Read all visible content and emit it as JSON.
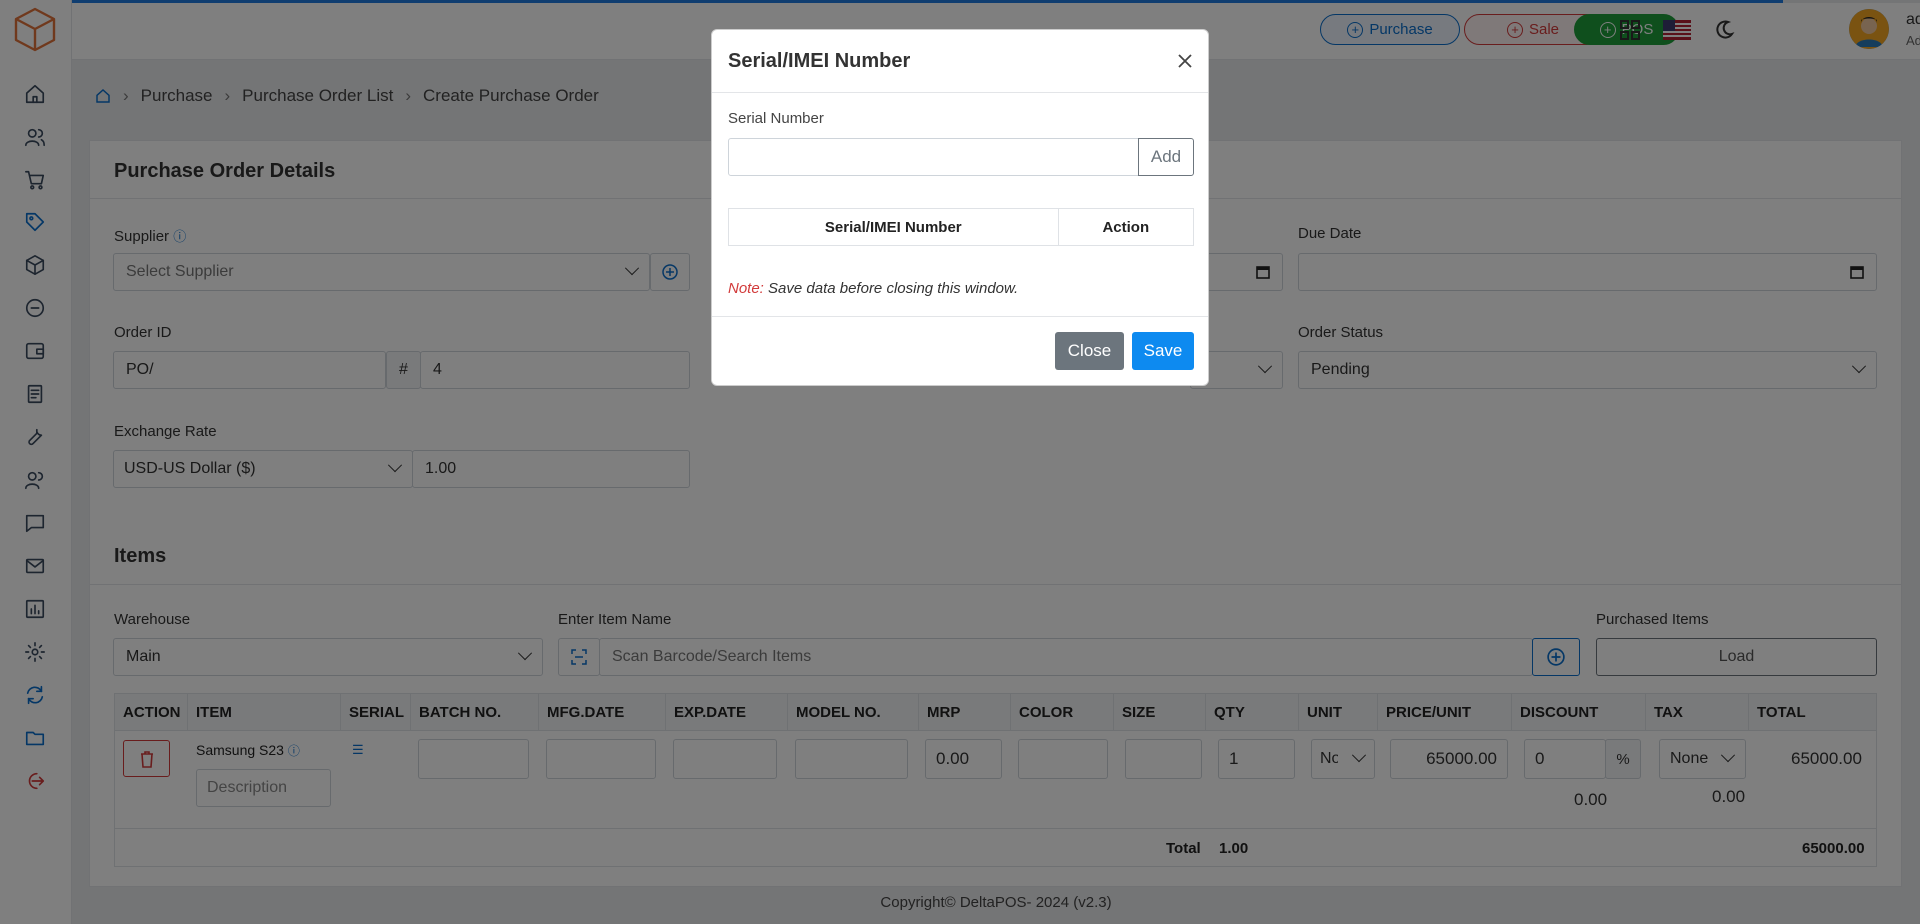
{
  "header": {
    "purchase_btn": "Purchase",
    "sale_btn": "Sale",
    "pos_btn": "POS",
    "user_name": "admin",
    "user_role": "Admin"
  },
  "breadcrumb": [
    "Purchase",
    "Purchase Order List",
    "Create Purchase Order"
  ],
  "details": {
    "title": "Purchase Order Details",
    "supplier_label": "Supplier",
    "supplier_placeholder": "Select Supplier",
    "due_date_label": "Due Date",
    "order_id_label": "Order ID",
    "order_prefix": "PO/",
    "order_hash": "#",
    "order_number": "4",
    "order_status_label": "Order Status",
    "order_status_value": "Pending",
    "exchange_rate_label": "Exchange Rate",
    "currency_value": "USD-US Dollar ($)",
    "exchange_rate_value": "1.00"
  },
  "items": {
    "title": "Items",
    "warehouse_label": "Warehouse",
    "warehouse_value": "Main",
    "item_name_label": "Enter Item Name",
    "search_placeholder": "Scan Barcode/Search Items",
    "purchased_items_label": "Purchased Items",
    "load_btn": "Load",
    "columns": [
      "ACTION",
      "ITEM",
      "SERIAL",
      "BATCH NO.",
      "MFG.DATE",
      "EXP.DATE",
      "MODEL NO.",
      "MRP",
      "COLOR",
      "SIZE",
      "QTY",
      "UNIT",
      "PRICE/UNIT",
      "DISCOUNT",
      "TAX",
      "TOTAL"
    ],
    "row": {
      "item_name": "Samsung S23",
      "description_placeholder": "Description",
      "mrp": "0.00",
      "qty": "1",
      "unit": "No",
      "price": "65000.00",
      "discount": "0",
      "discount_type": "%",
      "discount_amount": "0.00",
      "tax": "None",
      "tax_amount": "0.00",
      "total": "65000.00"
    },
    "footer": {
      "total_label": "Total",
      "total_qty": "1.00",
      "grand_total": "65000.00"
    }
  },
  "footer_text": "Copyright© DeltaPOS- 2024 (v2.3)",
  "modal": {
    "title": "Serial/IMEI Number",
    "serial_label": "Serial Number",
    "add_btn": "Add",
    "col_serial": "Serial/IMEI Number",
    "col_action": "Action",
    "note_label": "Note:",
    "note_text": " Save data before closing this window.",
    "close_btn": "Close",
    "save_btn": "Save"
  },
  "colors": {
    "accent": "#0d8af0",
    "danger": "#d23b3b",
    "success": "#1e9e3a"
  }
}
